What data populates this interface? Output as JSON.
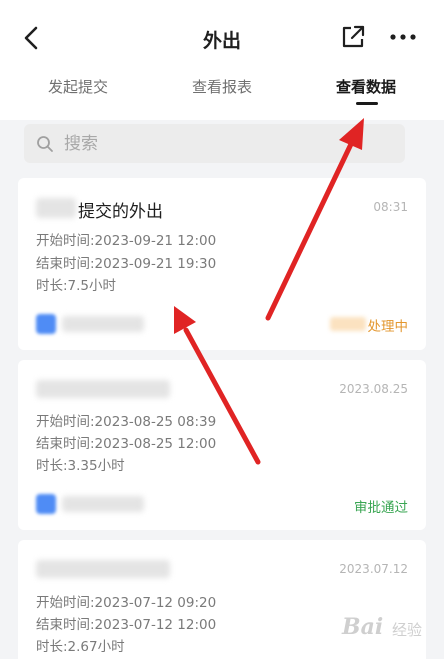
{
  "header": {
    "title": "外出",
    "back_icon": "chevron-left-icon",
    "share_icon": "external-share-icon",
    "more_icon": "more-dots-icon"
  },
  "tabs": [
    {
      "label": "发起提交",
      "active": false
    },
    {
      "label": "查看报表",
      "active": false
    },
    {
      "label": "查看数据",
      "active": true
    }
  ],
  "search": {
    "placeholder": "搜索",
    "value": ""
  },
  "records": [
    {
      "title_suffix": "提交的外出",
      "time": "08:31",
      "start": "开始时间:2023-09-21 12:00",
      "end": "结束时间:2023-09-21 19:30",
      "duration": "时长:7.5小时",
      "status": "处理中"
    },
    {
      "title_suffix": "",
      "time": "2023.08.25",
      "start": "开始时间:2023-08-25 08:39",
      "end": "结束时间:2023-08-25 12:00",
      "duration": "时长:3.35小时",
      "status": "审批通过"
    },
    {
      "title_suffix": "",
      "time": "2023.07.12",
      "start": "开始时间:2023-07-12 09:20",
      "end": "结束时间:2023-07-12 12:00",
      "duration": "时长:2.67小时",
      "status": ""
    }
  ],
  "colors": {
    "annotation_arrow": "#e02424",
    "status_processing": "#e3972f",
    "status_approved": "#3aa653"
  },
  "watermark": {
    "text": "Bai",
    "sub": "经验"
  }
}
